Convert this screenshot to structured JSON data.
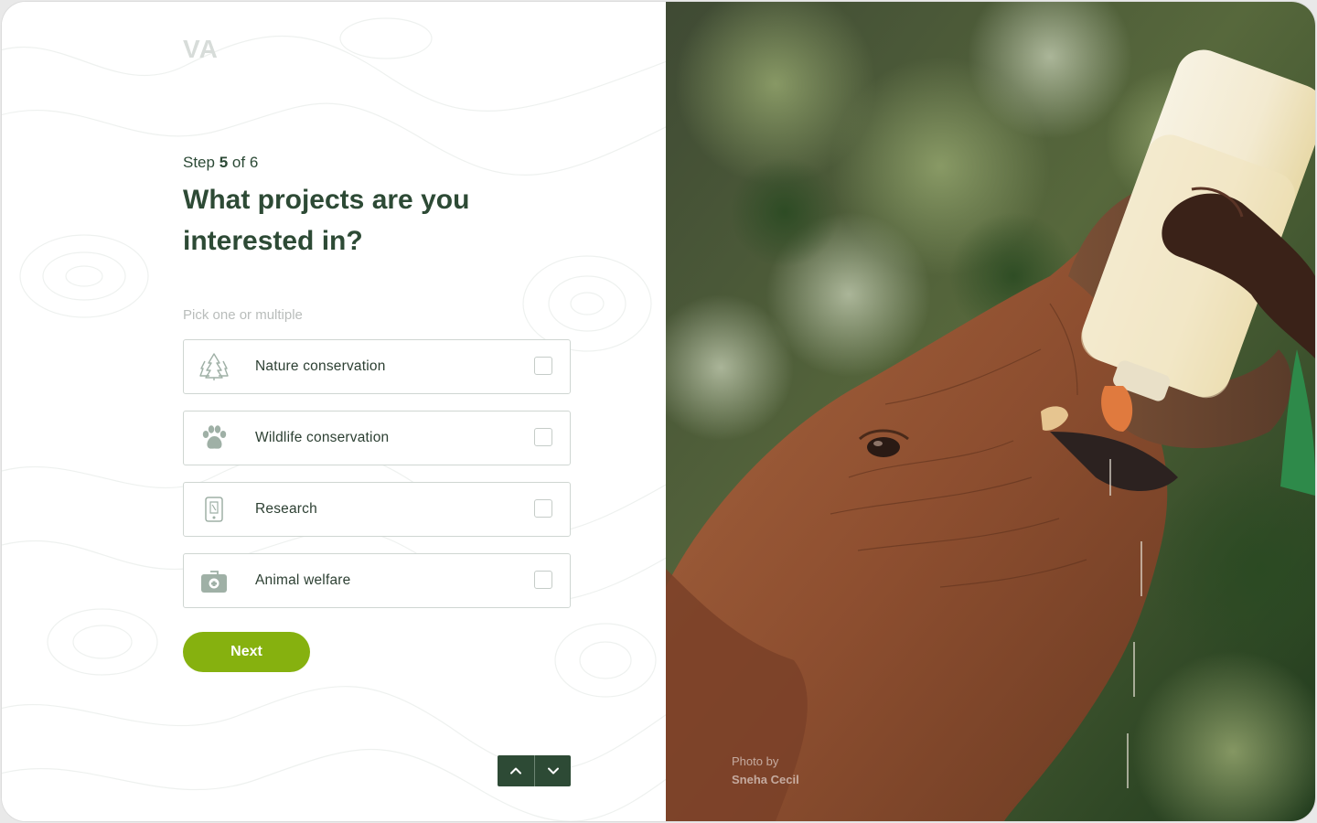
{
  "brand": {
    "logo_text": "VA"
  },
  "step": {
    "prefix": "Step",
    "current": "5",
    "separator": "of",
    "total": "6"
  },
  "question": {
    "title": "What projects are you interested in?",
    "hint": "Pick one or multiple"
  },
  "options": [
    {
      "label": "Nature conservation",
      "icon": "trees-icon",
      "checked": false
    },
    {
      "label": "Wildlife conservation",
      "icon": "paw-icon",
      "checked": false
    },
    {
      "label": "Research",
      "icon": "device-icon",
      "checked": false
    },
    {
      "label": "Animal welfare",
      "icon": "vet-kit-icon",
      "checked": false
    }
  ],
  "actions": {
    "next_label": "Next",
    "up_icon": "chevron-up-icon",
    "down_icon": "chevron-down-icon"
  },
  "photo": {
    "credit_prefix": "Photo by",
    "credit_name": "Sneha Cecil",
    "subject": "baby elephant drinking milk from a bottle"
  },
  "colors": {
    "primary": "#2d4a35",
    "accent": "#86b10f",
    "border": "#cfd6d2",
    "hint": "#b9bdbb",
    "icon": "#9fb0a6"
  }
}
